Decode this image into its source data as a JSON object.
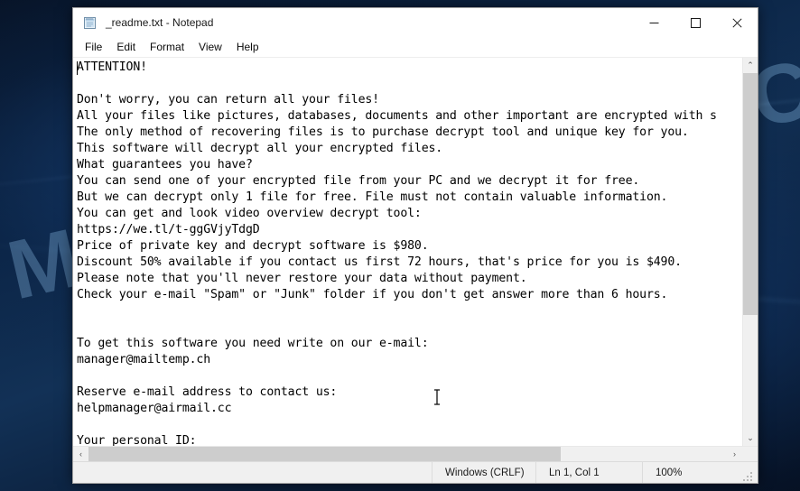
{
  "desktop": {
    "watermark": "MYANTISPYWARE.COM",
    "background_color": "#0b2445"
  },
  "window": {
    "title": "_readme.txt - Notepad",
    "icon": "notepad-icon",
    "controls": {
      "minimize": "—",
      "maximize": "□",
      "close": "✕"
    }
  },
  "menu": {
    "items": [
      {
        "label": "File"
      },
      {
        "label": "Edit"
      },
      {
        "label": "Format"
      },
      {
        "label": "View"
      },
      {
        "label": "Help"
      }
    ]
  },
  "document": {
    "filename": "_readme.txt",
    "body": "ATTENTION!\n\nDon't worry, you can return all your files!\nAll your files like pictures, databases, documents and other important are encrypted with s\nThe only method of recovering files is to purchase decrypt tool and unique key for you.\nThis software will decrypt all your encrypted files.\nWhat guarantees you have?\nYou can send one of your encrypted file from your PC and we decrypt it for free.\nBut we can decrypt only 1 file for free. File must not contain valuable information.\nYou can get and look video overview decrypt tool:\nhttps://we.tl/t-ggGVjyTdgD\nPrice of private key and decrypt software is $980.\nDiscount 50% available if you contact us first 72 hours, that's price for you is $490.\nPlease note that you'll never restore your data without payment.\nCheck your e-mail \"Spam\" or \"Junk\" folder if you don't get answer more than 6 hours.\n\n\nTo get this software you need write on our e-mail:\nmanager@mailtemp.ch\n\nReserve e-mail address to contact us:\nhelpmanager@airmail.cc\n\nYour personal ID:",
    "ransom": {
      "video_url": "https://we.tl/t-ggGVjyTdgD",
      "price_full": "$980",
      "price_discount": "$490",
      "discount_percent": "50%",
      "discount_window": "72 hours",
      "reply_time": "6 hours",
      "email_primary": "manager@mailtemp.ch",
      "email_reserve": "helpmanager@airmail.cc"
    }
  },
  "scrollbars": {
    "vertical": {
      "up_arrow": "⌃",
      "down_arrow": "⌄"
    },
    "horizontal": {
      "left_arrow": "‹",
      "right_arrow": "›"
    }
  },
  "status_bar": {
    "encoding": "Windows (CRLF)",
    "position": "Ln 1, Col 1",
    "zoom": "100%"
  }
}
